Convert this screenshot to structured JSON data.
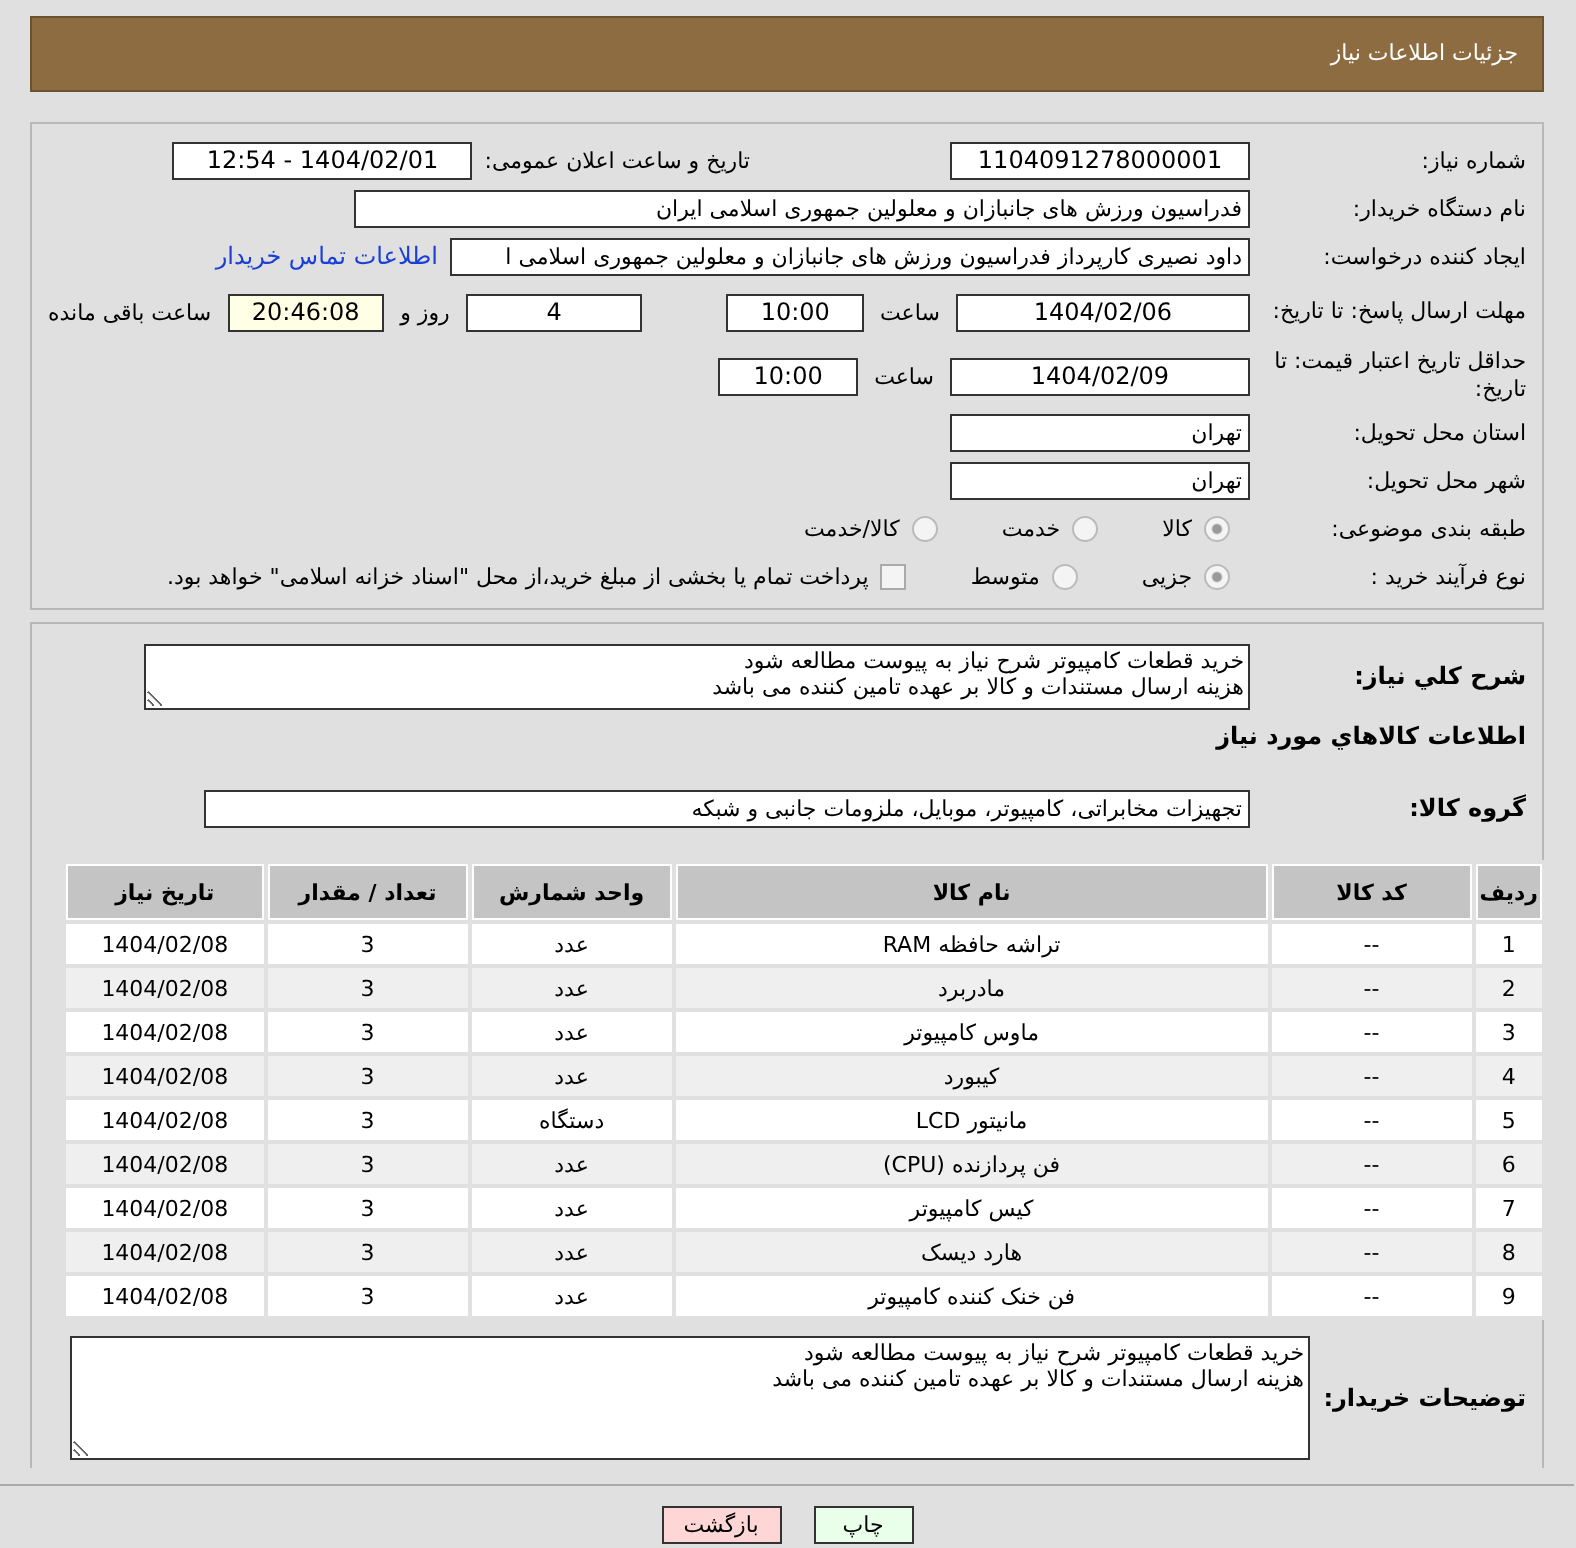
{
  "page_title": "جزئیات اطلاعات نیاز",
  "need_number": {
    "label": "شماره نیاز:",
    "value": "1104091278000001"
  },
  "announce": {
    "label": "تاریخ و ساعت اعلان عمومی:",
    "value": "1404/02/01 - 12:54"
  },
  "buyer_org": {
    "label": "نام دستگاه خریدار:",
    "value": "فدراسیون ورزش های جانبازان و معلولین جمهوری اسلامی ایران"
  },
  "requester": {
    "label": "ایجاد کننده درخواست:",
    "value": "داود نصیری کارپرداز فدراسیون ورزش های جانبازان و معلولین جمهوری اسلامی ا",
    "link": "اطلاعات تماس خریدار"
  },
  "reply_deadline": {
    "label": "مهلت ارسال پاسخ: تا تاریخ:",
    "date": "1404/02/06",
    "time_label": "ساعت",
    "time": "10:00",
    "days": "4",
    "days_label": "روز و",
    "remaining": "20:46:08",
    "remaining_label": "ساعت باقی مانده"
  },
  "price_validity": {
    "label": "حداقل تاریخ اعتبار قیمت: تا تاریخ:",
    "date": "1404/02/09",
    "time_label": "ساعت",
    "time": "10:00"
  },
  "province": {
    "label": "استان محل تحویل:",
    "value": "تهران"
  },
  "city": {
    "label": "شهر محل تحویل:",
    "value": "تهران"
  },
  "category": {
    "label": "طبقه بندی موضوعی:",
    "options": [
      {
        "label": "کالا",
        "selected": true
      },
      {
        "label": "خدمت",
        "selected": false
      },
      {
        "label": "کالا/خدمت",
        "selected": false
      }
    ]
  },
  "process": {
    "label": "نوع فرآیند خرید :",
    "options": [
      {
        "label": "جزیی",
        "selected": true
      },
      {
        "label": "متوسط",
        "selected": false
      }
    ],
    "treasury": {
      "label": "پرداخت تمام یا بخشی از مبلغ خرید،از محل \"اسناد خزانه اسلامی\" خواهد بود.",
      "checked": false
    }
  },
  "summary": {
    "label": "شرح کلي نياز:",
    "value": "خرید قطعات کامپیوتر شرح نیاز به پیوست مطالعه شود\nهزینه ارسال مستندات و کالا بر عهده تامین کننده می باشد"
  },
  "goods_heading": "اطلاعات کالاهاي مورد نياز",
  "goods_group": {
    "label": "گروه کالا:",
    "value": "تجهیزات مخابراتی، کامپیوتر، موبایل، ملزومات جانبی و شبکه"
  },
  "table": {
    "columns": [
      "ردیف",
      "کد کالا",
      "نام کالا",
      "واحد شمارش",
      "تعداد / مقدار",
      "تاریخ نیاز"
    ],
    "rows": [
      [
        "1",
        "--",
        "تراشه حافظه RAM",
        "عدد",
        "3",
        "1404/02/08"
      ],
      [
        "2",
        "--",
        "مادربرد",
        "عدد",
        "3",
        "1404/02/08"
      ],
      [
        "3",
        "--",
        "ماوس کامپیوتر",
        "عدد",
        "3",
        "1404/02/08"
      ],
      [
        "4",
        "--",
        "کیبورد",
        "عدد",
        "3",
        "1404/02/08"
      ],
      [
        "5",
        "--",
        "مانیتور LCD",
        "دستگاه",
        "3",
        "1404/02/08"
      ],
      [
        "6",
        "--",
        "فن پردازنده (CPU)",
        "عدد",
        "3",
        "1404/02/08"
      ],
      [
        "7",
        "--",
        "کیس کامپیوتر",
        "عدد",
        "3",
        "1404/02/08"
      ],
      [
        "8",
        "--",
        "هارد دیسک",
        "عدد",
        "3",
        "1404/02/08"
      ],
      [
        "9",
        "--",
        "فن خنک کننده کامپیوتر",
        "عدد",
        "3",
        "1404/02/08"
      ]
    ]
  },
  "buyer_notes": {
    "label": "توضیحات خریدار:",
    "value": "خرید قطعات کامپیوتر شرح نیاز به پیوست مطالعه شود\nهزینه ارسال مستندات و کالا بر عهده تامین کننده می باشد"
  },
  "buttons": [
    {
      "label": "چاپ",
      "kind": "print"
    },
    {
      "label": "بازگشت",
      "kind": "back"
    }
  ]
}
